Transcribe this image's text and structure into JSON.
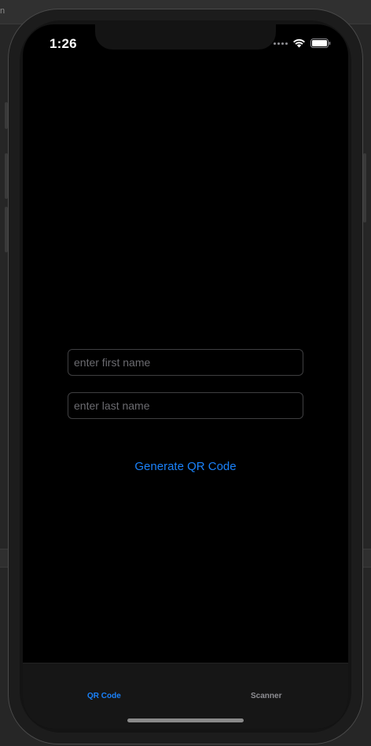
{
  "status_bar": {
    "time": "1:26"
  },
  "form": {
    "first_name_placeholder": "enter first name",
    "last_name_placeholder": "enter last name",
    "generate_button_label": "Generate QR Code"
  },
  "tab_bar": {
    "tabs": [
      {
        "label": "QR Code",
        "selected": true
      },
      {
        "label": "Scanner",
        "selected": false
      }
    ]
  },
  "colors": {
    "accent": "#1a82fb",
    "tab_inactive": "#8e8e93",
    "screen_bg": "#000000"
  },
  "desktop": {
    "corner_letter": "n"
  }
}
